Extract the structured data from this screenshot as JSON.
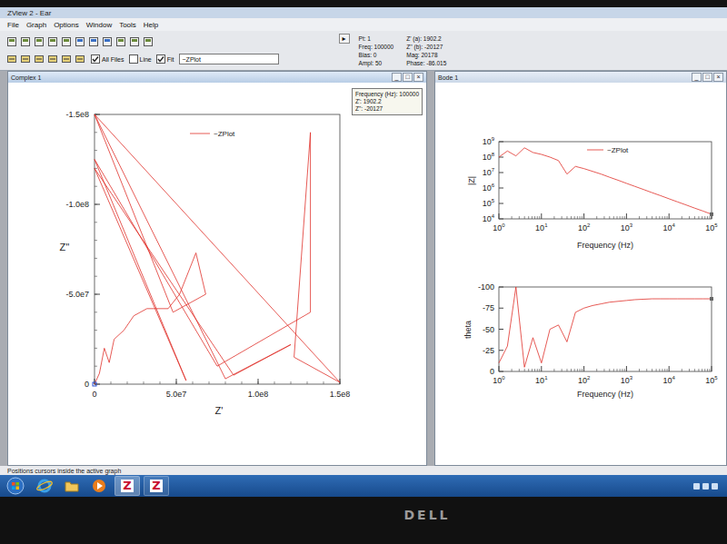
{
  "window": {
    "title": "ZView 2 - Ear"
  },
  "menu": [
    "File",
    "Graph",
    "Options",
    "Window",
    "Tools",
    "Help"
  ],
  "toolbar": {
    "checkboxes": [
      {
        "label": "All Files",
        "checked": true
      },
      {
        "label": "Line",
        "checked": false
      },
      {
        "label": "Fit",
        "checked": true
      }
    ],
    "series_select": "~ZPlot",
    "nav_button": "▸"
  },
  "readout": {
    "left": [
      "Pt: 1",
      "Freq: 100000",
      "Bias: 0",
      "Ampl: 50"
    ],
    "right": [
      "Z' (a): 1902.2",
      "Z'' (b): -20127",
      "Mag: 20178",
      "Phase: -86.015"
    ]
  },
  "window_buttons": [
    "_",
    "□",
    "×"
  ],
  "complex_window": {
    "title": "Complex 1",
    "active": true,
    "tooltip": [
      "Frequency (Hz): 100000",
      "Z': 1902.2",
      "Z'': -20127"
    ],
    "legend": "~ZPlot",
    "x_label": "Z'",
    "y_label": "Z''",
    "x_ticks": [
      {
        "label": "0",
        "value": 0
      },
      {
        "label": "5.0e7",
        "value": 50000000
      },
      {
        "label": "1.0e8",
        "value": 100000000
      },
      {
        "label": "1.5e8",
        "value": 150000000
      }
    ],
    "y_ticks": [
      {
        "label": "-1.5e8",
        "value": -150000000
      },
      {
        "label": "-1.0e8",
        "value": -100000000
      },
      {
        "label": "-5.0e7",
        "value": -50000000
      },
      {
        "label": "0",
        "value": 0
      }
    ],
    "series": {
      "z_real": [
        0,
        3000000,
        6000000,
        9000000,
        12000000,
        18000000,
        24000000,
        32000000,
        45000000,
        52000000,
        62000000,
        68000000,
        48000000,
        0,
        150000000,
        122000000,
        132000000,
        132000000,
        75000000,
        0,
        56000000,
        0,
        85000000,
        120000000,
        80000000,
        0
      ],
      "z_imag": [
        0,
        -6000000,
        -20000000,
        -12000000,
        -25000000,
        -30000000,
        -38000000,
        -42000000,
        -42000000,
        -50000000,
        -73000000,
        -50000000,
        -40000000,
        -150000000,
        -1000000,
        -15000000,
        -140000000,
        -40000000,
        -10000000,
        -125000000,
        -2000000,
        -120000000,
        -5000000,
        -22000000,
        -3000000,
        -150000000
      ]
    }
  },
  "bode_window": {
    "title": "Bode 1",
    "active": false,
    "legend": "~ZPlot",
    "mag_label": "|Z|",
    "phase_label": "theta",
    "x_label": "Frequency (Hz)",
    "mag_ticks": [
      {
        "base": "10",
        "exp": "9"
      },
      {
        "base": "10",
        "exp": "8"
      },
      {
        "base": "10",
        "exp": "7"
      },
      {
        "base": "10",
        "exp": "6"
      },
      {
        "base": "10",
        "exp": "5"
      },
      {
        "base": "10",
        "exp": "4"
      }
    ],
    "freq_ticks": [
      {
        "base": "10",
        "exp": "0"
      },
      {
        "base": "10",
        "exp": "1"
      },
      {
        "base": "10",
        "exp": "2"
      },
      {
        "base": "10",
        "exp": "3"
      },
      {
        "base": "10",
        "exp": "4"
      },
      {
        "base": "10",
        "exp": "5"
      }
    ],
    "phase_ticks": [
      {
        "label": "-100",
        "value": -100
      },
      {
        "label": "-75",
        "value": -75
      },
      {
        "label": "-50",
        "value": -50
      },
      {
        "label": "-25",
        "value": -25
      },
      {
        "label": "0",
        "value": 0
      }
    ],
    "series": {
      "freq": [
        1,
        1.585,
        2.512,
        3.981,
        6.31,
        10,
        15.85,
        25.12,
        39.81,
        63.1,
        100,
        158.5,
        251.2,
        398.1,
        631,
        1000,
        1585,
        2512,
        3981,
        6310,
        10000,
        15850,
        25120,
        39810,
        63100,
        100000
      ],
      "mag": [
        100000000,
        250000000,
        120000000,
        400000000,
        200000000,
        150000000,
        100000000,
        60000000,
        8000000,
        25000000,
        18000000,
        12000000,
        8000000,
        5000000,
        3200000,
        2000000,
        1260000,
        800000,
        500000,
        320000,
        200000,
        126000,
        80000,
        50000,
        32000,
        20000
      ],
      "phase": [
        -10,
        -30,
        -100,
        -5,
        -40,
        -10,
        -50,
        -55,
        -35,
        -70,
        -75,
        -78,
        -80,
        -82,
        -83,
        -84,
        -85,
        -85.5,
        -86,
        -86,
        -86,
        -86,
        -86,
        -86,
        -86,
        -86
      ]
    }
  },
  "status_bar": "Positions cursors inside the active graph",
  "taskbar": {
    "app_glyphs": [
      "Z",
      "Z"
    ]
  },
  "bezel": {
    "logo": "DELL"
  }
}
